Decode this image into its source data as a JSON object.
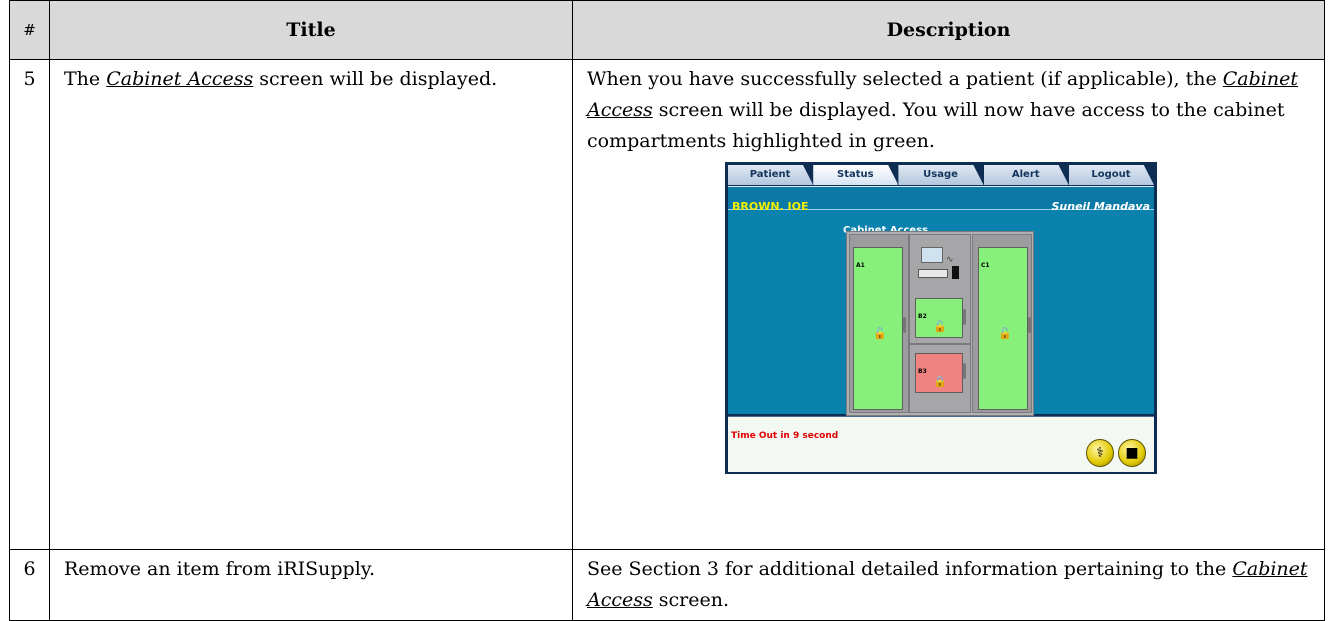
{
  "table": {
    "headers": {
      "num": "#",
      "title": "Title",
      "description": "Description"
    },
    "rows": [
      {
        "num": "5",
        "title_prefix": "The ",
        "title_link": "Cabinet Access",
        "title_suffix": " screen will be displayed.",
        "desc_prefix": "When you have successfully selected a patient (if applicable), the ",
        "desc_link": "Cabinet Access",
        "desc_suffix": " screen will be displayed.  You will now have access to the cabinet compartments highlighted in green."
      },
      {
        "num": "6",
        "title": "Remove an item from iRISupply.",
        "desc_prefix": "See Section 3 for additional detailed information pertaining to the ",
        "desc_link": "Cabinet Access",
        "desc_suffix": " screen."
      }
    ]
  },
  "screenshot": {
    "tabs": [
      "Patient",
      "Status",
      "Usage",
      "Alert",
      "Logout"
    ],
    "active_tab": "Status",
    "patient_name": "BROWN, JOE",
    "user_name": "Suneil Mandava",
    "section_title": "Cabinet Access",
    "doors": [
      {
        "label": "A1",
        "state": "unlocked",
        "color": "#86f07a"
      },
      {
        "label": "B2",
        "state": "unlocked",
        "color": "#86f07a"
      },
      {
        "label": "B3",
        "state": "locked",
        "color": "#f18282"
      },
      {
        "label": "C1",
        "state": "unlocked",
        "color": "#86f07a"
      }
    ],
    "timeout_text": "Time Out in 9 second",
    "buttons": [
      {
        "icon": "doctor-icon"
      },
      {
        "icon": "exit-door-icon"
      }
    ]
  }
}
